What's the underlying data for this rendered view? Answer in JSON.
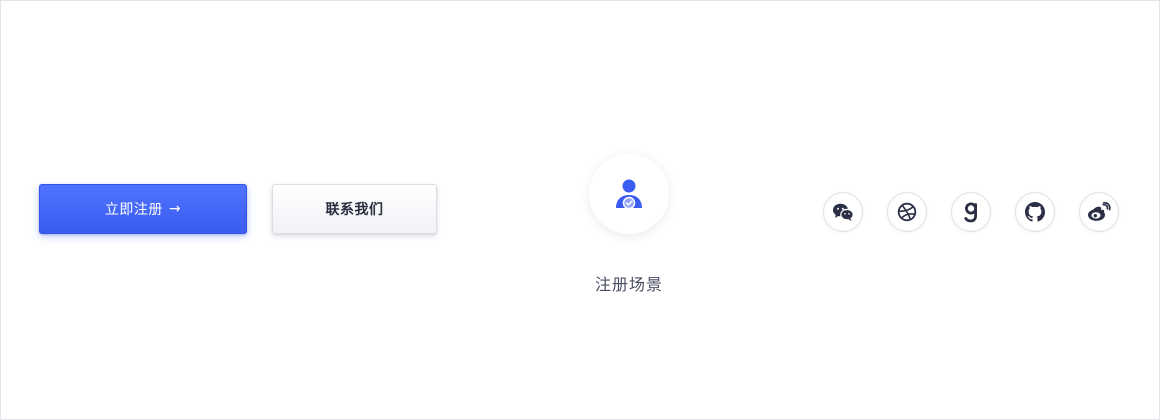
{
  "actions": {
    "register_label": "立即注册",
    "register_arrow": "→",
    "contact_label": "联系我们"
  },
  "scene": {
    "label": "注册场景",
    "icon": "user-verified-icon"
  },
  "social": [
    {
      "icon": "wechat-icon"
    },
    {
      "icon": "dribbble-icon"
    },
    {
      "icon": "goodreads-icon"
    },
    {
      "icon": "github-icon"
    },
    {
      "icon": "weibo-icon"
    }
  ],
  "colors": {
    "primary": "#3a5cf0",
    "icon_dark": "#2b2f45",
    "text_muted": "#4a4e63"
  }
}
